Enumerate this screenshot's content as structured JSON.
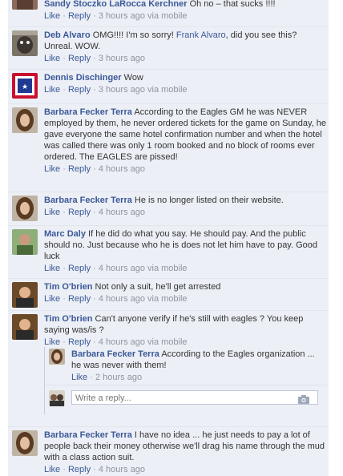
{
  "comments": [
    {
      "author": "Sandy Stoczko LaRocca Kerchner",
      "text": " Oh no – that sucks !!!!",
      "actions": {
        "like": "Like",
        "reply": "Reply",
        "meta": "3 hours ago via mobile"
      }
    },
    {
      "author": "Deb Alvaro",
      "text_before": " OMG!!!! I'm so sorry! ",
      "mention": "Frank Alvaro",
      "text_after": ", did you see this? Unreal. WOW.",
      "actions": {
        "like": "Like",
        "reply": "Reply",
        "meta": "3 hours ago"
      }
    },
    {
      "author": "Dennis Dischinger",
      "text": " Wow",
      "actions": {
        "like": "Like",
        "reply": "Reply",
        "meta": "3 hours ago via mobile"
      }
    },
    {
      "author": "Barbara Fecker Terra",
      "text": " According to the Eagles GM he was NEVER employed by them, he never ordered tickets for the game on Sunday, he gave everyone the same hotel confirmation number and when the hotel was called there was only 1 room booked and no block of rooms ever ordered. The EAGLES are pissed!",
      "actions": {
        "like": "Like",
        "reply": "Reply",
        "meta": "4 hours ago"
      }
    },
    {
      "author": "Barbara Fecker Terra",
      "text": " He is no longer listed on their website.",
      "actions": {
        "like": "Like",
        "reply": "Reply",
        "meta": "4 hours ago"
      }
    },
    {
      "author": "Marc Daly",
      "text": " If he did do what you say. He should pay. And the public should no. Just because who he is does not let him have to pay. Good luck",
      "actions": {
        "like": "Like",
        "reply": "Reply",
        "meta": "4 hours ago via mobile"
      }
    },
    {
      "author": "Tim O'brien",
      "text": " Not only a suit, he'll get arrested",
      "actions": {
        "like": "Like",
        "reply": "Reply",
        "meta": "4 hours ago via mobile"
      }
    },
    {
      "author": "Tim O'brien",
      "text": " Can't anyone verify if he's still with eagles ? You keep saying was/is ?",
      "actions": {
        "like": "Like",
        "reply": "Reply",
        "meta": "4 hours ago via mobile"
      }
    },
    {
      "author": "Barbara Fecker Terra",
      "text": " I have no idea ... he just needs to pay a lot of people back their money otherwise we'll drag his name through the mud with a class action suit.",
      "actions": {
        "like": "Like",
        "reply": "Reply",
        "meta": "4 hours ago"
      }
    }
  ],
  "reply": {
    "author": "Barbara Fecker Terra",
    "text": " According to the Eagles organization ... he was never with them!",
    "actions": {
      "like": "Like",
      "meta": "2 hours ago"
    }
  },
  "reply_form": {
    "placeholder": "Write a reply...",
    "icon": "camera-icon"
  },
  "separator": " · "
}
